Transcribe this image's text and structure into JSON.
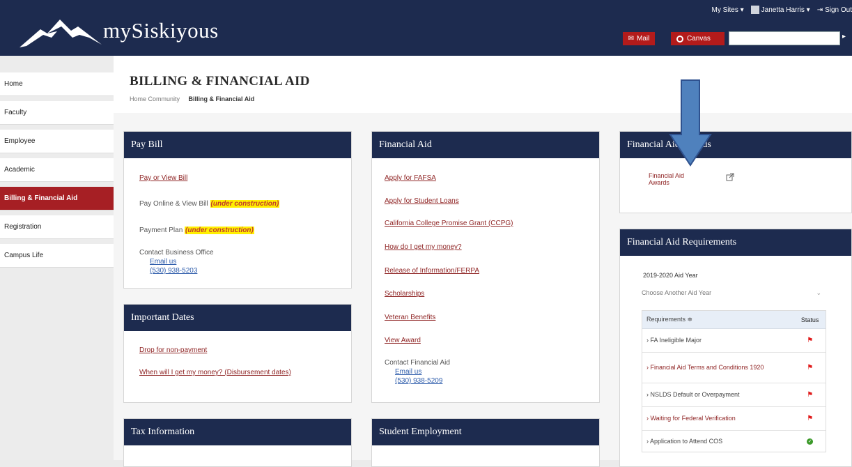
{
  "header": {
    "logo_text": "mySiskiyous",
    "my_sites": "My Sites ▾",
    "user_name": "Janetta Harris ▾",
    "sign_out": "Sign Out",
    "mail_label": "Mail",
    "canvas_label": "Canvas",
    "search_placeholder": "",
    "brand_color": "#1d2b4f",
    "accent_color": "#b31b1b"
  },
  "sidebar": {
    "items": [
      {
        "label": "Home"
      },
      {
        "label": "Faculty"
      },
      {
        "label": "Employee"
      },
      {
        "label": "Academic"
      },
      {
        "label": "Billing & Financial Aid"
      },
      {
        "label": "Registration"
      },
      {
        "label": "Campus Life"
      }
    ],
    "active": "Billing & Financial Aid"
  },
  "page": {
    "title": "BILLING & FINANCIAL AID",
    "breadcrumb_home": "Home Community",
    "breadcrumb_current": "Billing & Financial Aid"
  },
  "pay_bill": {
    "title": "Pay Bill",
    "link1": "Pay or View Bill",
    "item2": "Pay Online & View Bill",
    "item2_note": "(under construction)",
    "item3": "Payment Plan",
    "item3_note": "(under construction)",
    "contact_label": "Contact Business Office",
    "email_label": "Email us",
    "phone": "(530) 938-5203"
  },
  "important_dates": {
    "title": "Important Dates",
    "link1": "Drop for non-payment",
    "link2": "When will I get my money? (Disbursement dates)"
  },
  "tax_info": {
    "title": "Tax Information"
  },
  "financial_aid": {
    "title": "Financial Aid",
    "links": [
      "Apply for FAFSA",
      "Apply for Student Loans",
      "California College Promise Grant (CCPG)",
      "How do I get my money?",
      "Release of Information/FERPA",
      "Scholarships",
      "Veteran Benefits",
      "View Award"
    ],
    "contact_label": "Contact Financial Aid",
    "email_label": "Email us",
    "phone": "(530) 938-5209"
  },
  "student_employment": {
    "title": "Student Employment"
  },
  "fa_awards": {
    "title": "Financial Aid Awards",
    "link_line1": "Financial Aid",
    "link_line2": "Awards"
  },
  "fa_requirements": {
    "title": "Financial Aid Requirements",
    "aid_year": "2019-2020 Aid Year",
    "select_label": "Choose Another Aid Year",
    "col_requirements": "Requirements ≑",
    "col_status": "Status",
    "rows": [
      {
        "name": "FA Ineligible Major",
        "status": "flag"
      },
      {
        "name": "Financial Aid Terms and Conditions 1920",
        "status": "flag"
      },
      {
        "name": "NSLDS Default or Overpayment",
        "status": "flag"
      },
      {
        "name": "Waiting for Federal Verification",
        "status": "flag"
      },
      {
        "name": "Application to Attend COS",
        "status": "check"
      }
    ]
  }
}
